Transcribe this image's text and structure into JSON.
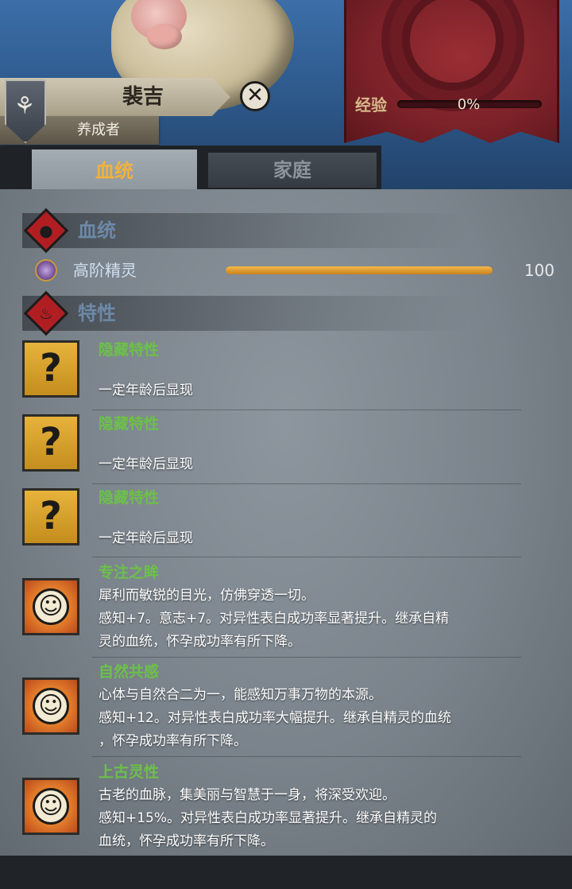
{
  "character": {
    "name": "裴吉",
    "role": "养成者",
    "close_symbol": "✕",
    "emblem_icon": "shield-emblem-icon"
  },
  "experience": {
    "label": "经验",
    "value_text": "0%",
    "progress": 0.0
  },
  "tabs": [
    {
      "label": "血统",
      "active": true
    },
    {
      "label": "家庭",
      "active": false
    }
  ],
  "bloodline_section": {
    "title": "血统",
    "icon": "blood-drop-icon",
    "entry": {
      "name": "高阶精灵",
      "value_text": "100",
      "progress": 1.0,
      "icon": "elf-orb-icon"
    }
  },
  "traits_section": {
    "title": "特性",
    "icon": "flame-icon",
    "items": [
      {
        "name": "隐藏特性",
        "icon": "question-mark-icon",
        "lines": [
          "一定年龄后显现"
        ]
      },
      {
        "name": "隐藏特性",
        "icon": "question-mark-icon",
        "lines": [
          "一定年龄后显现"
        ]
      },
      {
        "name": "隐藏特性",
        "icon": "question-mark-icon",
        "lines": [
          "一定年龄后显现"
        ]
      },
      {
        "name": "专注之眸",
        "icon": "sun-face-icon",
        "lines": [
          "犀利而敏锐的目光，仿佛穿透一切。",
          "感知+7。意志+7。对异性表白成功率显著提升。继承自精",
          "灵的血统，怀孕成功率有所下降。"
        ]
      },
      {
        "name": "自然共感",
        "icon": "sun-face-icon",
        "lines": [
          "心体与自然合二为一，能感知万事万物的本源。",
          "感知+12。对异性表白成功率大幅提升。继承自精灵的血统",
          "，怀孕成功率有所下降。"
        ]
      },
      {
        "name": "上古灵性",
        "icon": "sun-face-icon",
        "lines": [
          "古老的血脉，集美丽与智慧于一身，将深受欢迎。",
          "感知+15%。对异性表白成功率显著提升。继承自精灵的",
          "血统，怀孕成功率有所下降。"
        ]
      }
    ]
  },
  "colors": {
    "accent_tab": "#f0b23d",
    "trait_name": "#6cc04a",
    "section_title": "#6d89a8"
  }
}
